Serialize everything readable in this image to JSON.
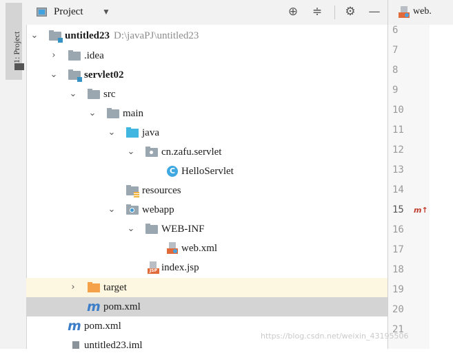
{
  "sidebar": {
    "label": "1: Project"
  },
  "header": {
    "title": "Project",
    "dropdown_icon": "caret-down-icon",
    "actions": [
      "locate-icon",
      "collapse-all-icon",
      "gear-icon",
      "hide-icon"
    ]
  },
  "tree": {
    "root_name": "untitled23",
    "root_path": "D:\\javaPJ\\untitled23",
    "idea": ".idea",
    "module": "servlet02",
    "src": "src",
    "main": "main",
    "java": "java",
    "package": "cn.zafu.servlet",
    "class": "HelloServlet",
    "class_icon_letter": "C",
    "resources": "resources",
    "webapp": "webapp",
    "webinf": "WEB-INF",
    "webxml": "web.xml",
    "indexjsp": "index.jsp",
    "jsp_badge": "JSP",
    "target": "target",
    "module_pom": "pom.xml",
    "root_pom": "pom.xml",
    "iml": "untitled23.iml",
    "maven_icon_letter": "m"
  },
  "editor": {
    "tab_label": "web.",
    "line_numbers": [
      "6",
      "7",
      "8",
      "9",
      "10",
      "11",
      "12",
      "13",
      "14",
      "15",
      "16",
      "17",
      "18",
      "19",
      "20",
      "21"
    ],
    "current_line": "15",
    "line_marker": "m↑"
  },
  "watermark": "https://blog.csdn.net/weixin_43195506",
  "colors": {
    "selection": "#d4d4d4",
    "highlight": "#fdf6e0",
    "folder_blue": "#40b6e0",
    "folder_orange": "#f4a14a"
  }
}
